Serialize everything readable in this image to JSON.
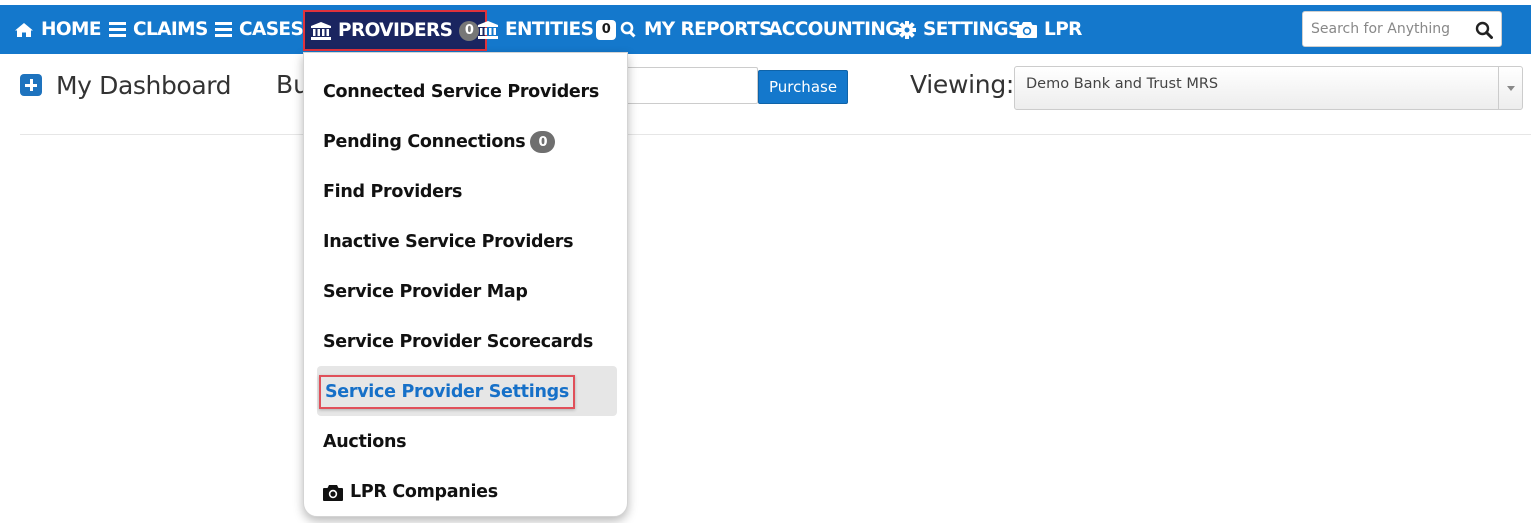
{
  "nav": {
    "home": "HOME",
    "claims": "CLAIMS",
    "cases": "CASES",
    "providers": "PROVIDERS",
    "providers_badge": "0",
    "entities": "ENTITIES",
    "entities_badge": "0",
    "my_reports": "MY REPORTS",
    "accounting": "ACCOUNTING",
    "settings": "SETTINGS",
    "lpr": "LPR",
    "search_placeholder": "Search for Anything"
  },
  "header": {
    "title": "My Dashboard",
    "bu_text": "Bu",
    "purchase_label": "Purchase",
    "viewing_label": "Viewing:",
    "viewing_value": "Demo Bank and Trust MRS"
  },
  "dropdown": {
    "items": [
      {
        "label": "Connected Service Providers"
      },
      {
        "label": "Pending Connections",
        "badge": "0"
      },
      {
        "label": "Find Providers"
      },
      {
        "label": "Inactive Service Providers"
      },
      {
        "label": "Service Provider Map"
      },
      {
        "label": "Service Provider Scorecards"
      },
      {
        "label": "Service Provider Settings",
        "selected": true
      },
      {
        "label": "Auctions"
      },
      {
        "label": "LPR Companies",
        "icon": "camera-icon"
      }
    ]
  },
  "colors": {
    "nav_bg": "#1478cc",
    "active_nav_bg": "#1a2560",
    "highlight_border": "#e0323c",
    "selected_text": "#1670c8"
  },
  "icons": {
    "home": "home-icon",
    "claims": "bars-icon",
    "cases": "bars-icon",
    "providers": "bank-icon",
    "entities": "bank-icon",
    "my_reports": "search-icon",
    "settings": "gear-icon",
    "lpr": "camera-icon",
    "search": "search-icon",
    "dashboard": "plus-square-icon"
  }
}
